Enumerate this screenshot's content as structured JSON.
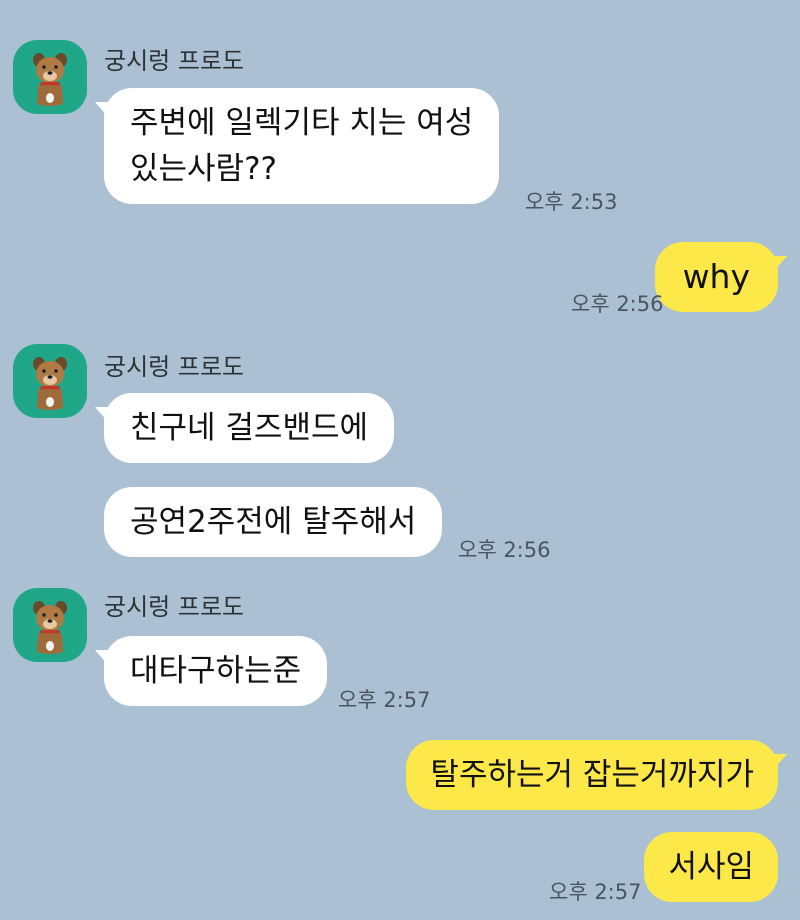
{
  "chat": {
    "sender_name": "궁시렁 프로도",
    "messages": [
      {
        "id": "m1",
        "direction": "in",
        "lines": [
          "주변에 일렉기타 치는 여성",
          "있는사람??"
        ],
        "time": "오후 2:53"
      },
      {
        "id": "m2",
        "direction": "out",
        "text": "why",
        "time": "오후 2:56"
      },
      {
        "id": "m3",
        "direction": "in",
        "text": "친구네 걸즈밴드에"
      },
      {
        "id": "m4",
        "direction": "in",
        "text": "공연2주전에 탈주해서",
        "time": "오후 2:56"
      },
      {
        "id": "m5",
        "direction": "in",
        "text": "대타구하는준",
        "time": "오후 2:57"
      },
      {
        "id": "m6",
        "direction": "out",
        "text": "탈주하는거 잡는거까지가"
      },
      {
        "id": "m7",
        "direction": "out",
        "text": "서사임",
        "time": "오후 2:57"
      }
    ]
  },
  "colors": {
    "background": "#abc0d3",
    "incoming_bubble": "#ffffff",
    "outgoing_bubble": "#fde84a",
    "avatar_bg": "#1fa788"
  },
  "icons": {
    "avatar": "frodo-character-avatar-icon"
  }
}
